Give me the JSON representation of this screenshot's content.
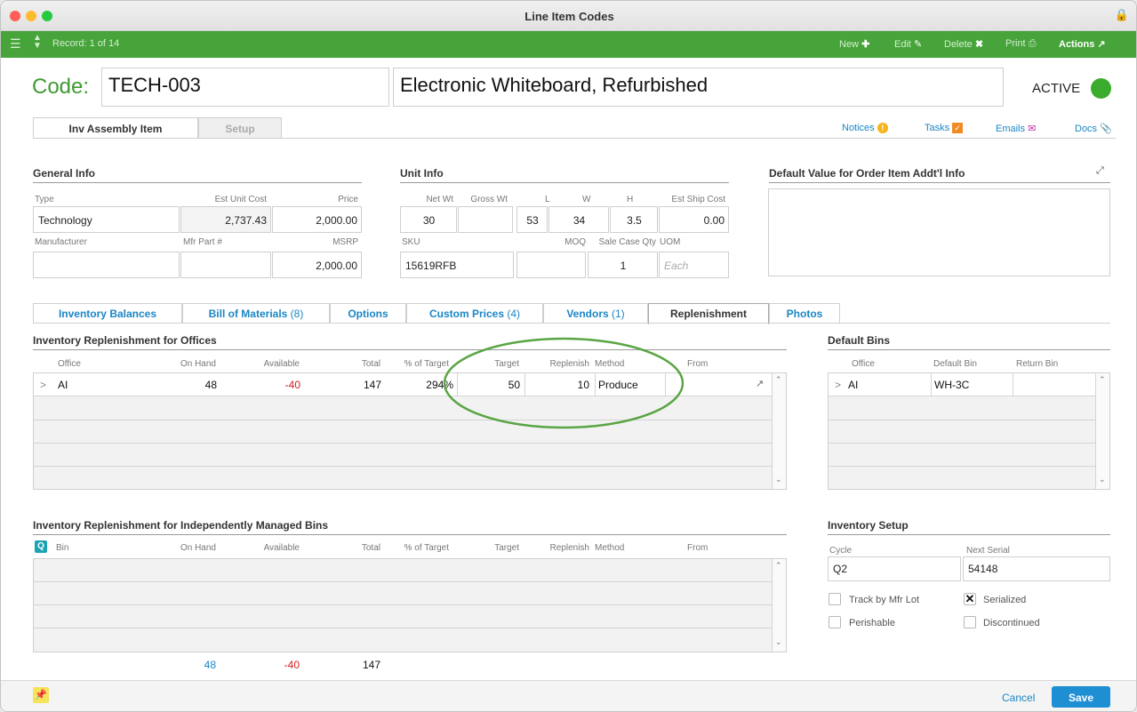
{
  "window": {
    "title": "Line Item Codes"
  },
  "toolbar": {
    "record": "Record: 1 of 14",
    "new": "New",
    "edit": "Edit",
    "delete": "Delete",
    "print": "Print",
    "actions": "Actions"
  },
  "header": {
    "code_label": "Code:",
    "code": "TECH-003",
    "description": "Electronic Whiteboard, Refurbished",
    "status": "ACTIVE",
    "status_color": "#3bab2d"
  },
  "tabs": {
    "main": "Inv Assembly Item",
    "setup": "Setup"
  },
  "links": {
    "notices": "Notices",
    "tasks": "Tasks",
    "emails": "Emails",
    "docs": "Docs"
  },
  "general": {
    "title": "General Info",
    "type_label": "Type",
    "est_unit_cost_label": "Est Unit Cost",
    "price_label": "Price",
    "type": "Technology",
    "est_unit_cost": "2,737.43",
    "price": "2,000.00",
    "manufacturer_label": "Manufacturer",
    "mfr_part_label": "Mfr Part #",
    "msrp_label": "MSRP",
    "manufacturer": "",
    "mfr_part": "",
    "msrp": "2,000.00"
  },
  "unit": {
    "title": "Unit Info",
    "net_wt_label": "Net Wt",
    "gross_wt_label": "Gross Wt",
    "l_label": "L",
    "w_label": "W",
    "h_label": "H",
    "ship_label": "Est Ship Cost",
    "net_wt": "30",
    "gross_wt": "",
    "l": "53",
    "w": "34",
    "h": "3.5",
    "ship": "0.00",
    "sku_label": "SKU",
    "moq_label": "MOQ",
    "sale_case_label": "Sale Case Qty",
    "uom_label": "UOM",
    "sku": "15619RFB",
    "moq": "",
    "sale_case": "1",
    "uom_placeholder": "Each"
  },
  "default_value": {
    "title": "Default Value for Order Item Addt'l Info"
  },
  "subtabs": [
    {
      "label": "Inventory Balances",
      "count": ""
    },
    {
      "label": "Bill of Materials",
      "count": "(8)"
    },
    {
      "label": "Options",
      "count": ""
    },
    {
      "label": "Custom Prices",
      "count": "(4)"
    },
    {
      "label": "Vendors",
      "count": "(1)"
    },
    {
      "label": "Replenishment",
      "count": ""
    },
    {
      "label": "Photos",
      "count": ""
    }
  ],
  "offices": {
    "title": "Inventory Replenishment for Offices",
    "columns": [
      "Office",
      "On Hand",
      "Available",
      "Total",
      "% of Target",
      "Target",
      "Replenish",
      "Method",
      "From"
    ],
    "rows": [
      {
        "expand": ">",
        "office": "AI",
        "on_hand": "48",
        "available": "-40",
        "total": "147",
        "pct": "294%",
        "target": "50",
        "replenish": "10",
        "method": "Produce",
        "from": ""
      }
    ]
  },
  "bins": {
    "title": "Default Bins",
    "columns": [
      "Office",
      "Default Bin",
      "Return Bin"
    ],
    "rows": [
      {
        "expand": ">",
        "office": "AI",
        "default_bin": "WH-3C",
        "return_bin": ""
      }
    ]
  },
  "managed": {
    "title": "Inventory Replenishment for Independently Managed Bins",
    "columns": [
      "Bin",
      "On Hand",
      "Available",
      "Total",
      "% of Target",
      "Target",
      "Replenish",
      "Method",
      "From"
    ],
    "totals": {
      "on_hand": "48",
      "available": "-40",
      "total": "147"
    }
  },
  "setup": {
    "title": "Inventory Setup",
    "cycle_label": "Cycle",
    "next_serial_label": "Next Serial",
    "cycle": "Q2",
    "next_serial": "54148",
    "track_lot": "Track by Mfr Lot",
    "serialized": "Serialized",
    "perishable": "Perishable",
    "discontinued": "Discontinued",
    "track_lot_checked": false,
    "serialized_checked": true,
    "perishable_checked": false,
    "discontinued_checked": false
  },
  "footer": {
    "cancel": "Cancel",
    "save": "Save"
  },
  "colors": {
    "toolbar": "#46a43a",
    "accent": "#1a86c4",
    "negative": "#d42020",
    "highlight_ring": "#5aa544"
  }
}
